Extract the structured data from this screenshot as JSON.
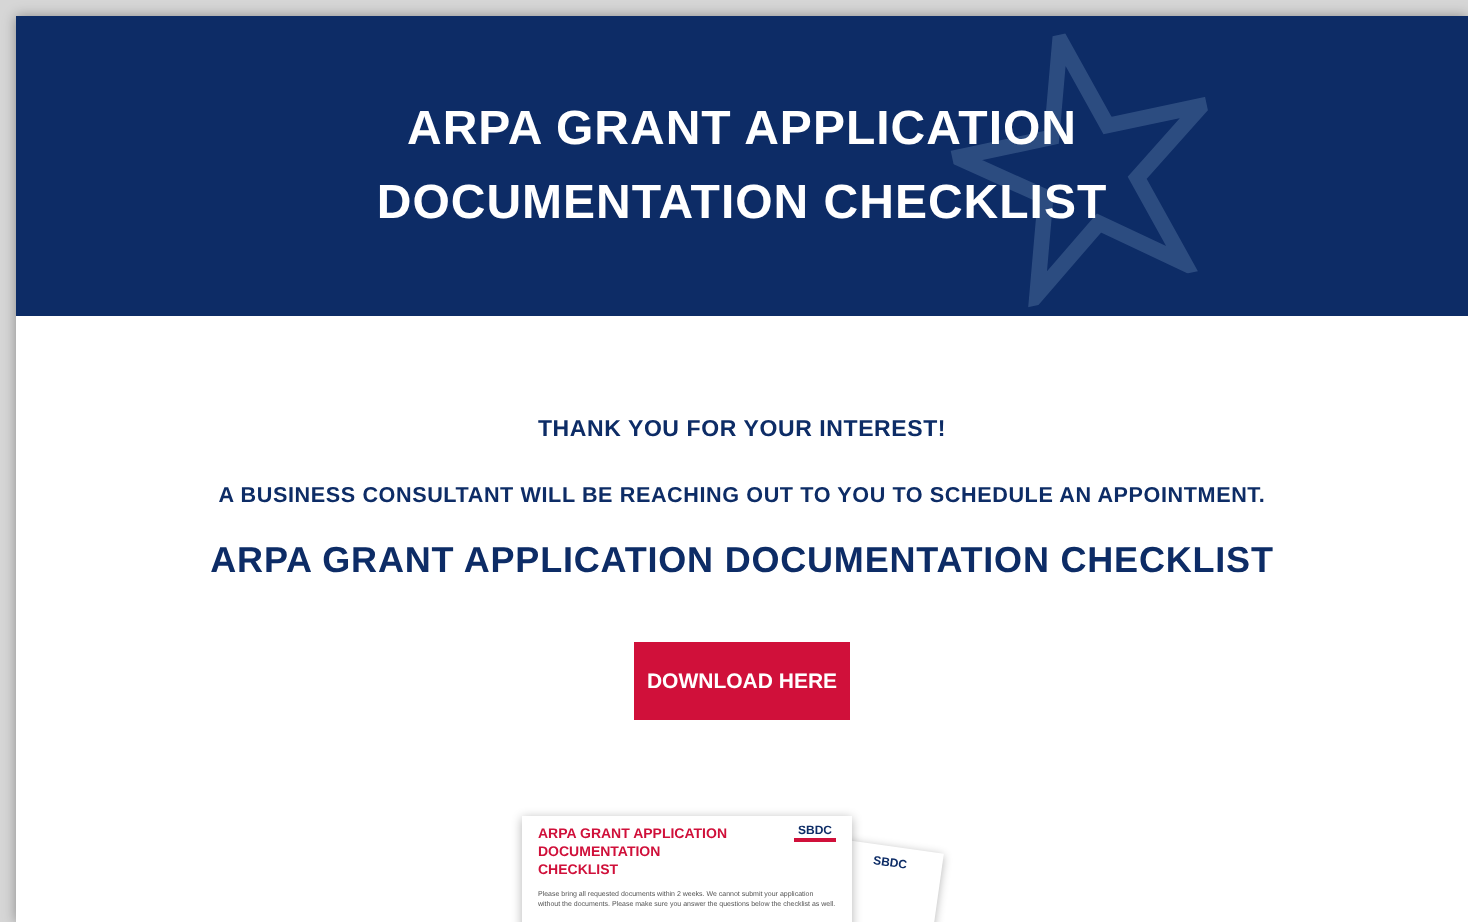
{
  "header": {
    "title": "ARPA GRANT APPLICATION DOCUMENTATION CHECKLIST"
  },
  "content": {
    "thanks": "THANK YOU FOR YOUR INTEREST!",
    "message": "A BUSINESS CONSULTANT WILL BE REACHING OUT TO YOU TO SCHEDULE AN APPOINTMENT.",
    "heading": "ARPA GRANT APPLICATION DOCUMENTATION CHECKLIST",
    "button": "DOWNLOAD HERE"
  },
  "preview": {
    "title": "ARPA GRANT APPLICATION DOCUMENTATION CHECKLIST",
    "logo": "SBDC",
    "intro": "Please bring all requested documents within 2 weeks. We cannot submit your application without the documents. Please make sure you answer the questions below the checklist as well.",
    "back_logo": "SBDC"
  }
}
